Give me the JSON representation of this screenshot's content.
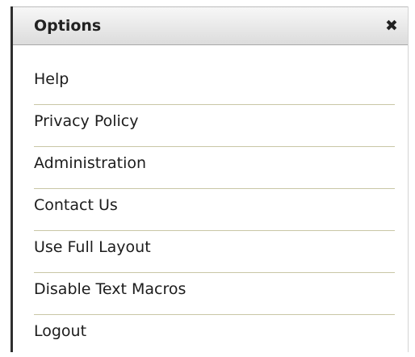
{
  "panel": {
    "title": "Options",
    "close_glyph": "✖",
    "close_icon": "close-icon"
  },
  "menu": {
    "items": [
      {
        "label": "Help"
      },
      {
        "label": "Privacy Policy"
      },
      {
        "label": "Administration"
      },
      {
        "label": "Contact Us"
      },
      {
        "label": "Use Full Layout"
      },
      {
        "label": "Disable Text Macros"
      },
      {
        "label": "Logout"
      }
    ]
  },
  "colors": {
    "header_top": "#f7f7f7",
    "header_bottom": "#dcdcdc",
    "divider": "#c9c6a6",
    "left_border": "#2e2e2e"
  }
}
